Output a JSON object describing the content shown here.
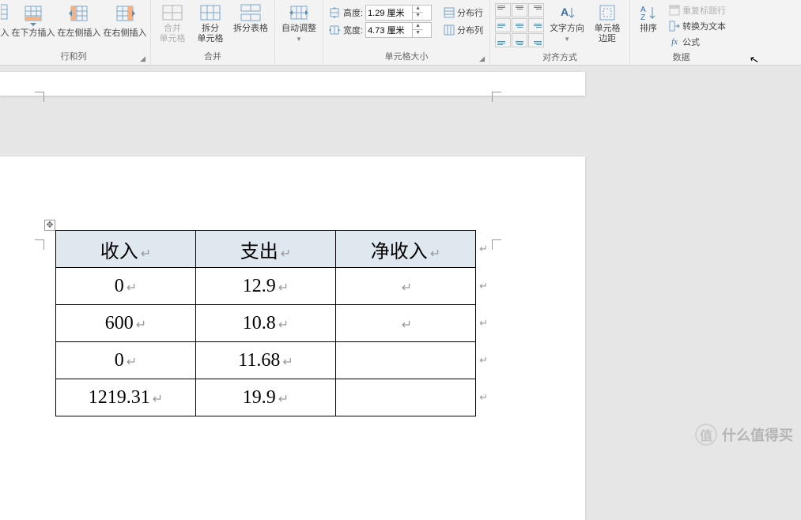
{
  "ribbon": {
    "rows_cols": {
      "label": "行和列",
      "insert_below": "在下方插入",
      "insert_left": "在左侧插入",
      "insert_right": "在右侧插入"
    },
    "merge": {
      "label": "合并",
      "merge_cells": "合并\n单元格",
      "split_cells": "拆分\n单元格",
      "split_table": "拆分表格"
    },
    "autofit": {
      "label": "自动调整"
    },
    "cell_size": {
      "label": "单元格大小",
      "height_label": "高度:",
      "width_label": "宽度:",
      "height_value": "1.29 厘米",
      "width_value": "4.73 厘米",
      "dist_rows": "分布行",
      "dist_cols": "分布列"
    },
    "alignment": {
      "label": "对齐方式",
      "text_dir": "文字方向",
      "cell_margins": "单元格\n边距"
    },
    "data": {
      "label": "数据",
      "sort": "排序",
      "repeat_header": "重复标题行",
      "to_text": "转换为文本",
      "formula": "公式"
    }
  },
  "table": {
    "headers": [
      "收入",
      "支出",
      "净收入"
    ],
    "rows": [
      [
        "0",
        "12.9",
        ""
      ],
      [
        "600",
        "10.8",
        ""
      ],
      [
        "0",
        "11.68",
        ""
      ],
      [
        "1219.31",
        "19.9",
        ""
      ]
    ]
  },
  "watermark": "什么值得买",
  "watermark_badge": "值"
}
